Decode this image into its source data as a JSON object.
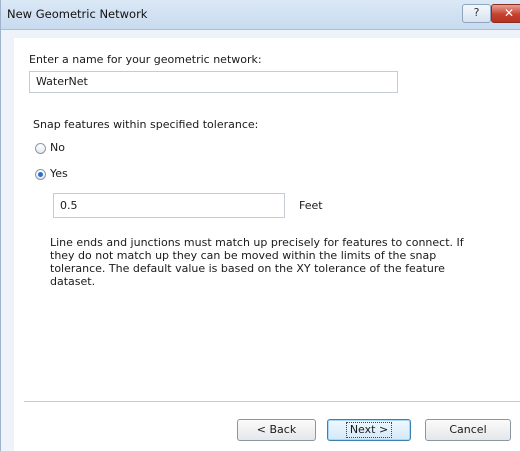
{
  "window": {
    "title": "New Geometric Network",
    "help_label": "?",
    "close_label": "✕"
  },
  "network_name": {
    "label": "Enter a name for your geometric network:",
    "value": "WaterNet"
  },
  "snap": {
    "label": "Snap features within specified tolerance:",
    "no_label": "No",
    "yes_label": "Yes",
    "selected": "Yes",
    "tolerance_value": "0.5",
    "units": "Feet",
    "description": "Line ends and junctions must match up precisely for features to connect. If they do not match up they can be moved within the limits of the snap tolerance. The default value is based on the XY tolerance of the feature dataset."
  },
  "buttons": {
    "back": "< Back",
    "next": "Next >",
    "cancel": "Cancel"
  }
}
